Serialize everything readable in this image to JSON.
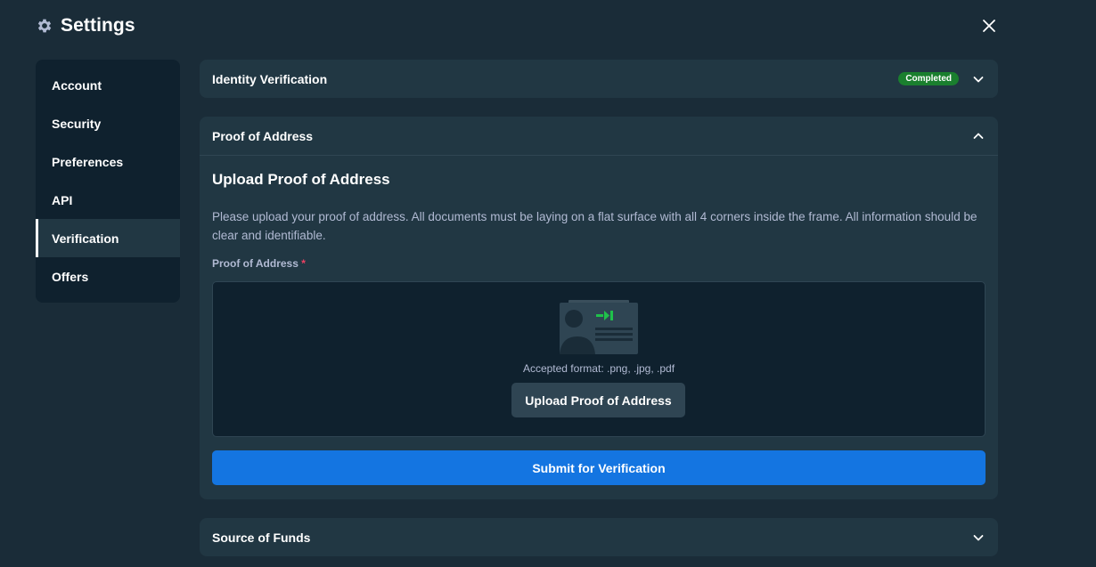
{
  "header": {
    "title": "Settings",
    "settings_icon": "gear-icon",
    "close_icon": "close-icon"
  },
  "sidebar": {
    "items": [
      {
        "label": "Account",
        "active": false
      },
      {
        "label": "Security",
        "active": false
      },
      {
        "label": "Preferences",
        "active": false
      },
      {
        "label": "API",
        "active": false
      },
      {
        "label": "Verification",
        "active": true
      },
      {
        "label": "Offers",
        "active": false
      }
    ]
  },
  "identity": {
    "title": "Identity Verification",
    "status": "Completed",
    "status_color": "#1a7f2e",
    "icon": "chevron-down-icon"
  },
  "address": {
    "title": "Proof of Address",
    "icon": "chevron-up-icon",
    "upload_title": "Upload Proof of Address",
    "description": "Please upload your proof of address. All documents must be laying on a flat surface with all 4 corners inside the frame. All information should be clear and identifiable.",
    "field_label": "Proof of Address",
    "required_mark": "*",
    "formats": "Accepted format: .png, .jpg, .pdf",
    "upload_button": "Upload Proof of Address",
    "submit_button": "Submit for Verification",
    "illustration_icon": "id-card-icon"
  },
  "funds": {
    "title": "Source of Funds",
    "icon": "chevron-down-icon"
  },
  "colors": {
    "background": "#1a2c38",
    "panel": "#213743",
    "sidebar": "#0f212e",
    "primary": "#1475e1",
    "success": "#1a7f2e",
    "required": "#ed4163"
  }
}
